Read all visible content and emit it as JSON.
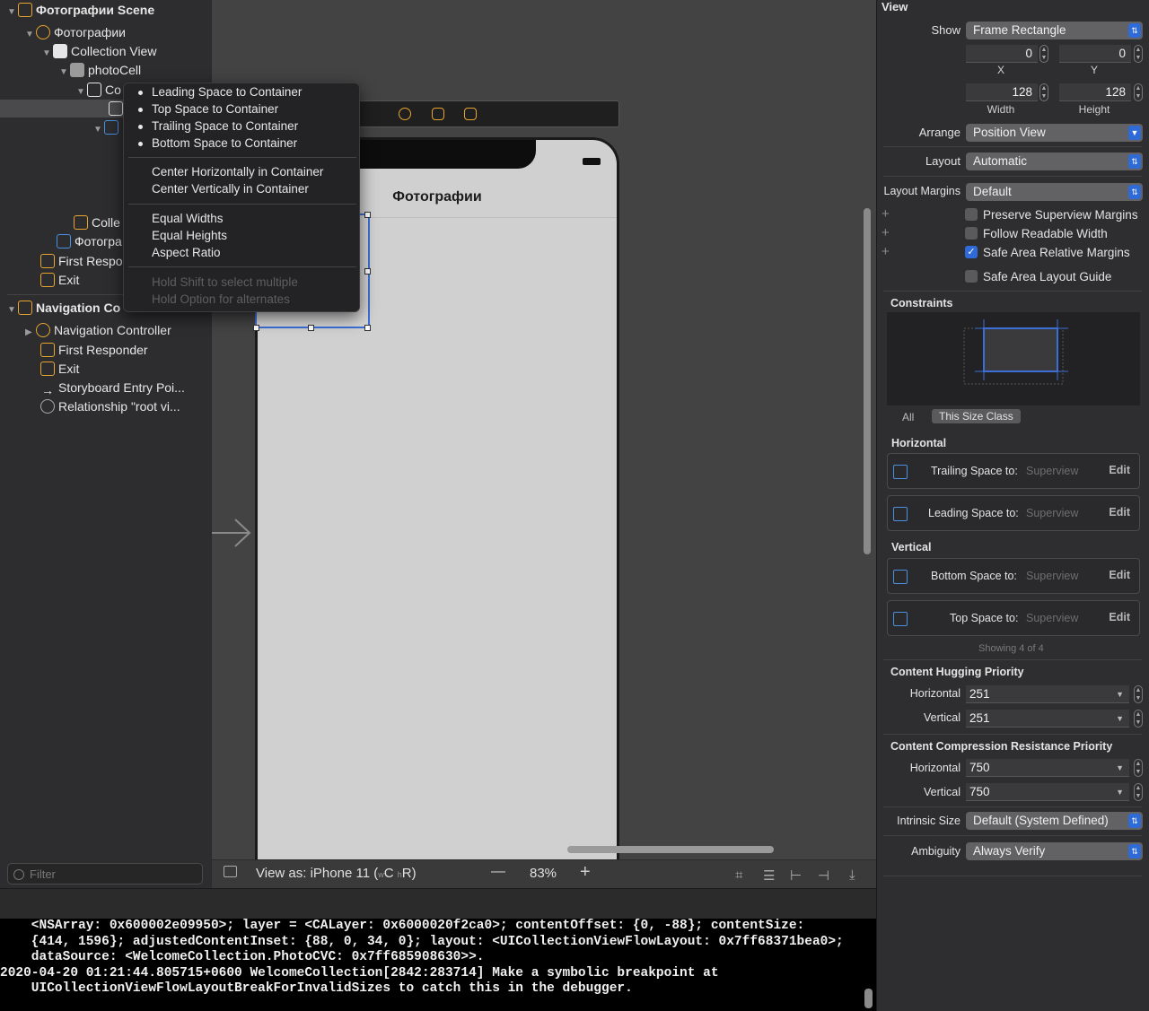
{
  "outline": {
    "items": [
      {
        "label": "Фотографии Scene",
        "bold": true
      },
      {
        "label": "Фотографии"
      },
      {
        "label": "Collection View"
      },
      {
        "label": "photoCell"
      },
      {
        "label": "Co"
      },
      {
        "label": "Colle"
      },
      {
        "label": "Фотогра"
      },
      {
        "label": "First Respo"
      },
      {
        "label": "Exit"
      },
      {
        "label": "Navigation Co",
        "bold": true
      },
      {
        "label": "Navigation Controller"
      },
      {
        "label": "First Responder"
      },
      {
        "label": "Exit"
      },
      {
        "label": "Storyboard Entry Poi..."
      },
      {
        "label": "Relationship \"root vi..."
      }
    ],
    "filter_placeholder": "Filter"
  },
  "menu": {
    "group1": [
      "Leading Space to Container",
      "Top Space to Container",
      "Trailing Space to Container",
      "Bottom Space to Container"
    ],
    "group2": [
      "Center Horizontally in Container",
      "Center Vertically in Container"
    ],
    "group3": [
      "Equal Widths",
      "Equal Heights",
      "Aspect Ratio"
    ],
    "hints": [
      "Hold Shift to select multiple",
      "Hold Option for alternates"
    ]
  },
  "canvas": {
    "nav_title": "Фотографии",
    "view_as": "View as: iPhone 11 (",
    "size_class_w": "w",
    "size_class_c": "C",
    "size_class_h": "h",
    "size_class_r": "R)",
    "zoom": "83%",
    "zoom_minus": "—",
    "zoom_plus": "+"
  },
  "console": {
    "lines": [
      "    <NSArray: 0x600002e09950>; layer = <CALayer: 0x6000020f2ca0>; contentOffset: {0, -88}; contentSize:",
      "    {414, 1596}; adjustedContentInset: {88, 0, 34, 0}; layout: <UICollectionViewFlowLayout: 0x7ff68371bea0>;",
      "    dataSource: <WelcomeCollection.PhotoCVC: 0x7ff685908630>>.",
      "2020-04-20 01:21:44.805715+0600 WelcomeCollection[2842:283714] Make a symbolic breakpoint at",
      "    UICollectionViewFlowLayoutBreakForInvalidSizes to catch this in the debugger."
    ]
  },
  "inspector": {
    "header": "View",
    "show_label": "Show",
    "show_value": "Frame Rectangle",
    "x_value": "0",
    "y_value": "0",
    "x_label": "X",
    "y_label": "Y",
    "width_value": "128",
    "height_value": "128",
    "width_label": "Width",
    "height_label": "Height",
    "arrange_label": "Arrange",
    "arrange_value": "Position View",
    "layout_label": "Layout",
    "layout_value": "Automatic",
    "margins_label": "Layout Margins",
    "margins_value": "Default",
    "checks": [
      {
        "label": "Preserve Superview Margins",
        "checked": false
      },
      {
        "label": "Follow Readable Width",
        "checked": false
      },
      {
        "label": "Safe Area Relative Margins",
        "checked": true
      },
      {
        "label": "Safe Area Layout Guide",
        "checked": false
      }
    ],
    "constraints_title": "Constraints",
    "tab_all": "All",
    "tab_size_class": "This Size Class",
    "horizontal_title": "Horizontal",
    "vertical_title": "Vertical",
    "horizontal_constraints": [
      {
        "label": "Trailing Space to:",
        "target": "Superview",
        "action": "Edit"
      },
      {
        "label": "Leading Space to:",
        "target": "Superview",
        "action": "Edit"
      }
    ],
    "vertical_constraints": [
      {
        "label": "Bottom Space to:",
        "target": "Superview",
        "action": "Edit"
      },
      {
        "label": "Top Space to:",
        "target": "Superview",
        "action": "Edit"
      }
    ],
    "showing": "Showing 4 of 4",
    "hugging_title": "Content Hugging Priority",
    "hugging_h_label": "Horizontal",
    "hugging_h": "251",
    "hugging_v_label": "Vertical",
    "hugging_v": "251",
    "compression_title": "Content Compression Resistance Priority",
    "compression_h_label": "Horizontal",
    "compression_h": "750",
    "compression_v_label": "Vertical",
    "compression_v": "750",
    "intrinsic_label": "Intrinsic Size",
    "intrinsic_value": "Default (System Defined)",
    "ambiguity_label": "Ambiguity",
    "ambiguity_value": "Always Verify"
  },
  "colors": {
    "accent": "#2f6ad9",
    "selection": "#3b6fd6",
    "icon_orange": "#e8a530"
  }
}
